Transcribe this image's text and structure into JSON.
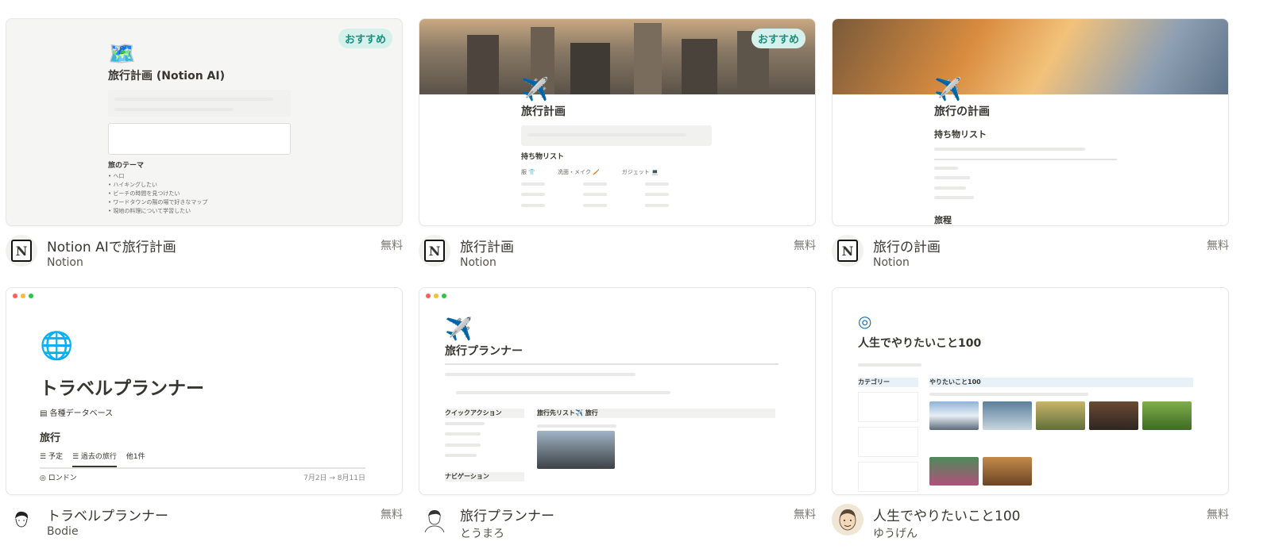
{
  "cards": [
    {
      "title": "Notion AIで旅行計画",
      "author": "Notion",
      "price": "無料",
      "badge": "おすすめ",
      "preview": {
        "heading": "旅行計画 (Notion AI)",
        "section": "旅のテーマ",
        "list": [
          "ヘ口",
          "ハイキングしたい",
          "ビーチの時間を見つけたい",
          "ワードタウンの陽の場で好きなマップ",
          "現地の料理について学習したい"
        ]
      }
    },
    {
      "title": "旅行計画",
      "author": "Notion",
      "price": "無料",
      "badge": "おすすめ",
      "preview": {
        "heading": "旅行計画",
        "section": "持ち物リスト",
        "columns": [
          "服 👕",
          "洗面・メイク 🪥",
          "ガジェット 💻"
        ]
      }
    },
    {
      "title": "旅行の計画",
      "author": "Notion",
      "price": "無料",
      "preview": {
        "heading": "旅行の計画",
        "section": "持ち物リスト",
        "section2": "旅程"
      }
    },
    {
      "title": "トラベルプランナー",
      "author": "Bodie",
      "price": "無料",
      "preview": {
        "heading": "トラベルプランナー",
        "db_label": "各種データベース",
        "section": "旅行",
        "tabs": [
          "予定",
          "過去の旅行",
          "他1件"
        ],
        "row_name": "ロンドン",
        "row_date": "7月2日 → 8月11日"
      }
    },
    {
      "title": "旅行プランナー",
      "author": "とうまろ",
      "price": "無料",
      "preview": {
        "heading": "旅行プランナー",
        "quick_actions": "クイックアクション",
        "navigation": "ナビゲーション",
        "board": "旅行先リスト✈️ 旅行"
      }
    },
    {
      "title": "人生でやりたいこと100",
      "author": "ゆうげん",
      "price": "無料",
      "preview": {
        "heading": "人生でやりたいこと100",
        "category": "カテゴリー",
        "gallery": "やりたいこと100"
      }
    }
  ],
  "colors": {
    "badge_bg": "#d6f0ec",
    "badge_text": "#1a8f7c",
    "border": "#e6e6e4"
  }
}
